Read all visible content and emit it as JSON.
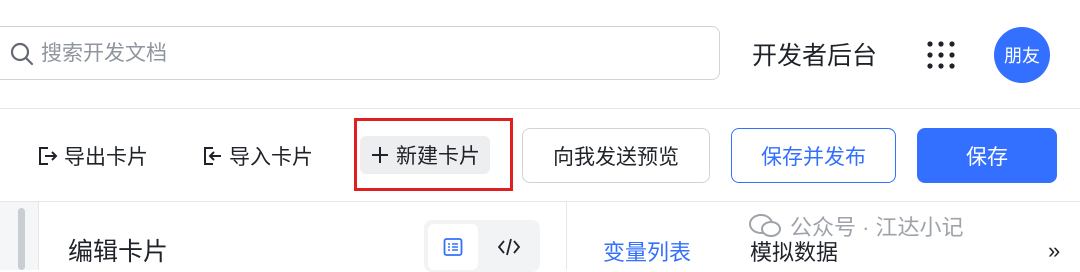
{
  "search": {
    "placeholder": "搜索开发文档"
  },
  "header": {
    "title": "开发者后台",
    "avatar_text": "朋友",
    "apps_icon": "grid-icon"
  },
  "toolbar": {
    "export_label": "导出卡片",
    "import_label": "导入卡片",
    "new_card_label": "新建卡片",
    "preview_label": "向我发送预览",
    "publish_label": "保存并发布",
    "save_label": "保存"
  },
  "editor": {
    "title": "编辑卡片",
    "tabs": [
      "变量列表",
      "模拟数据"
    ]
  },
  "watermark": {
    "text": "公众号 · 江达小记"
  },
  "colors": {
    "accent": "#3370ff",
    "highlight": "#e02020"
  }
}
